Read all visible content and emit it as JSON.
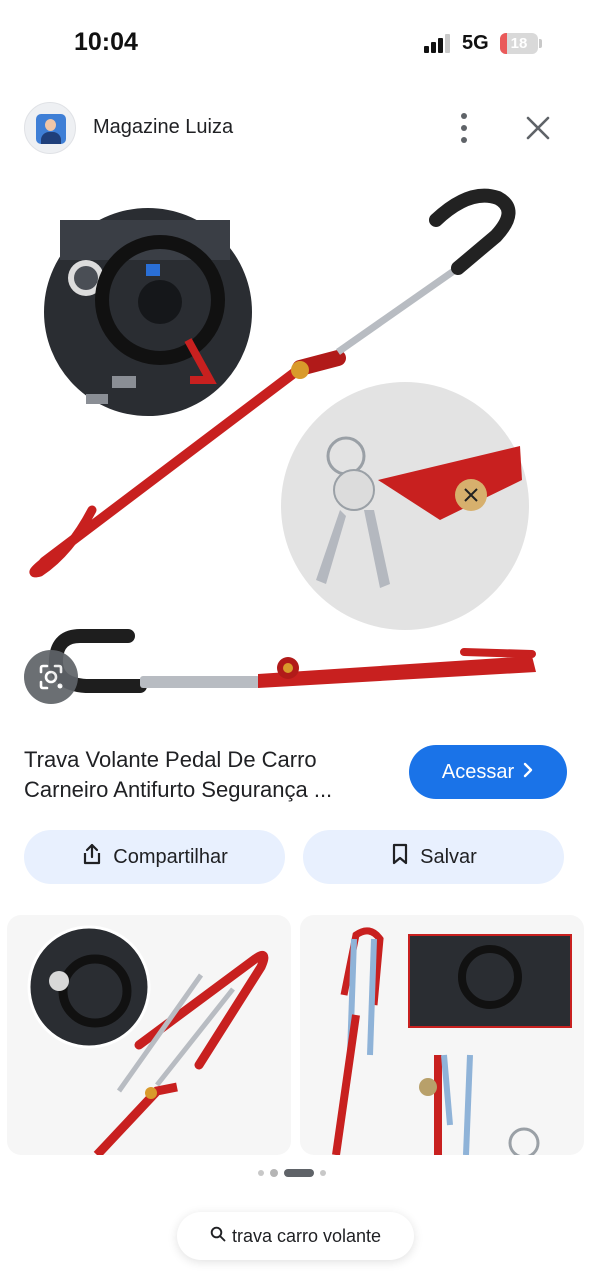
{
  "status_bar": {
    "time": "10:04",
    "network": "5G",
    "battery_level": "18",
    "signal_bars_on": 3,
    "signal_bars_total": 4
  },
  "source": {
    "name": "Magazine Luiza",
    "avatar_icon": "store-logo-icon",
    "more_icon": "more-vert-icon",
    "close_icon": "close-icon"
  },
  "product": {
    "title_line1": "Trava Volante Pedal De Carro",
    "title_line2": "Carneiro Antifurto Segurança ...",
    "visit_label": "Acessar",
    "visit_icon": "chevron-right-icon"
  },
  "actions": {
    "share_label": "Compartilhar",
    "share_icon": "share-icon",
    "save_label": "Salvar",
    "save_icon": "bookmark-icon"
  },
  "lens_icon": "lens-camera-icon",
  "pager": {
    "count": 4,
    "active_index": 2
  },
  "search_chip": {
    "label": "trava carro volante",
    "icon": "search-icon"
  },
  "colors": {
    "accent": "#1a73e8",
    "chip_bg": "#e8f0fe",
    "product_red": "#c8201f",
    "battery_red": "#ea5a5a"
  }
}
